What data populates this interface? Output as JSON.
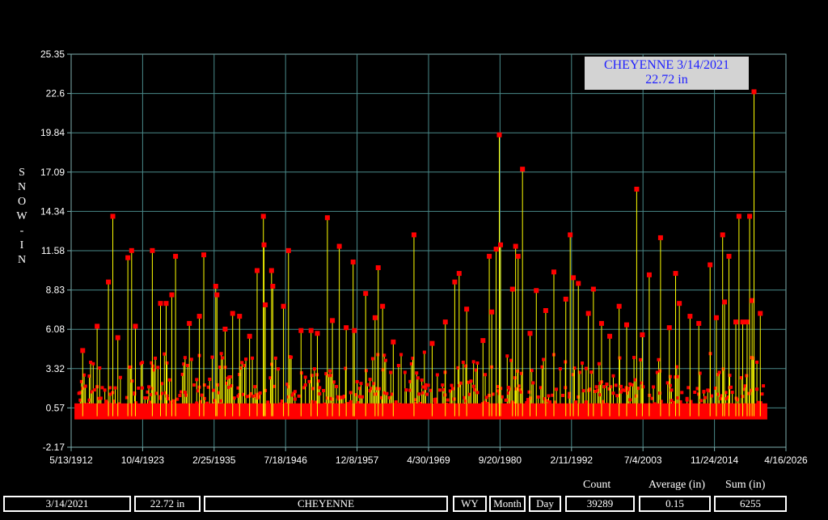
{
  "chart_data": {
    "type": "bar",
    "title": "",
    "ylabel": "SNOW-IN",
    "ylim": [
      -2.17,
      25.35
    ],
    "yticks": [
      "25.35",
      "22.6",
      "19.84",
      "17.09",
      "14.34",
      "11.58",
      "8.83",
      "6.08",
      "3.32",
      "0.57",
      "-2.17"
    ],
    "xticks": [
      "5/13/1912",
      "10/4/1923",
      "2/25/1935",
      "7/18/1946",
      "12/8/1957",
      "4/30/1969",
      "9/20/1980",
      "2/11/1992",
      "7/4/2003",
      "11/24/2014",
      "4/16/2026"
    ],
    "xrange_years": [
      1912.36,
      2026.29
    ],
    "grid": true,
    "series": [
      {
        "marker_color": "#ff0000",
        "line_color": "#ffff00",
        "points": [
          [
            1914.2,
            4.6
          ],
          [
            1916.5,
            6.3
          ],
          [
            1918.3,
            9.4
          ],
          [
            1919.0,
            14.0
          ],
          [
            1919.8,
            5.5
          ],
          [
            1921.4,
            11.1
          ],
          [
            1922.0,
            11.6
          ],
          [
            1922.6,
            6.3
          ],
          [
            1925.3,
            11.6
          ],
          [
            1926.6,
            7.9
          ],
          [
            1927.5,
            7.9
          ],
          [
            1928.4,
            8.5
          ],
          [
            1929.0,
            11.2
          ],
          [
            1931.2,
            6.5
          ],
          [
            1932.8,
            7.0
          ],
          [
            1933.5,
            11.3
          ],
          [
            1935.4,
            9.1
          ],
          [
            1935.6,
            8.5
          ],
          [
            1936.9,
            6.1
          ],
          [
            1938.1,
            7.2
          ],
          [
            1939.2,
            7.0
          ],
          [
            1940.8,
            5.6
          ],
          [
            1942.0,
            10.2
          ],
          [
            1943.0,
            14.0
          ],
          [
            1943.1,
            12.0
          ],
          [
            1943.3,
            7.8
          ],
          [
            1944.3,
            10.2
          ],
          [
            1944.5,
            9.1
          ],
          [
            1946.2,
            7.7
          ],
          [
            1947.0,
            11.6
          ],
          [
            1949.0,
            6.0
          ],
          [
            1950.6,
            6.0
          ],
          [
            1951.6,
            5.8
          ],
          [
            1953.2,
            13.9
          ],
          [
            1954.0,
            6.7
          ],
          [
            1955.1,
            11.9
          ],
          [
            1956.2,
            6.2
          ],
          [
            1957.3,
            10.8
          ],
          [
            1957.5,
            6.0
          ],
          [
            1959.3,
            8.6
          ],
          [
            1960.8,
            6.9
          ],
          [
            1961.3,
            10.4
          ],
          [
            1962.0,
            7.7
          ],
          [
            1963.7,
            5.2
          ],
          [
            1967.0,
            12.7
          ],
          [
            1969.9,
            5.1
          ],
          [
            1972.0,
            6.6
          ],
          [
            1973.5,
            9.4
          ],
          [
            1974.2,
            10.0
          ],
          [
            1975.4,
            7.5
          ],
          [
            1978.0,
            5.3
          ],
          [
            1979.0,
            11.2
          ],
          [
            1979.4,
            7.3
          ],
          [
            1980.1,
            11.7
          ],
          [
            1980.6,
            19.7
          ],
          [
            1980.8,
            12.0
          ],
          [
            1982.7,
            8.9
          ],
          [
            1983.2,
            11.9
          ],
          [
            1983.6,
            11.2
          ],
          [
            1984.3,
            17.3
          ],
          [
            1985.5,
            5.8
          ],
          [
            1986.5,
            8.8
          ],
          [
            1988.0,
            7.4
          ],
          [
            1989.3,
            10.1
          ],
          [
            1991.2,
            8.2
          ],
          [
            1991.9,
            12.7
          ],
          [
            1992.4,
            9.7
          ],
          [
            1993.2,
            9.3
          ],
          [
            1994.8,
            7.2
          ],
          [
            1995.6,
            8.9
          ],
          [
            1996.9,
            6.5
          ],
          [
            1998.2,
            5.6
          ],
          [
            1999.7,
            7.7
          ],
          [
            2000.9,
            6.4
          ],
          [
            2002.5,
            15.9
          ],
          [
            2003.4,
            5.7
          ],
          [
            2004.5,
            9.9
          ],
          [
            2006.3,
            12.5
          ],
          [
            2007.7,
            6.2
          ],
          [
            2008.7,
            10.0
          ],
          [
            2009.3,
            7.9
          ],
          [
            2011.0,
            7.0
          ],
          [
            2012.4,
            6.5
          ],
          [
            2014.2,
            10.6
          ],
          [
            2015.2,
            6.9
          ],
          [
            2016.2,
            12.7
          ],
          [
            2016.5,
            8.0
          ],
          [
            2017.2,
            11.2
          ],
          [
            2018.3,
            6.6
          ],
          [
            2018.8,
            14.0
          ],
          [
            2019.4,
            6.6
          ],
          [
            2020.1,
            6.6
          ],
          [
            2020.5,
            14.0
          ],
          [
            2020.9,
            8.1
          ],
          [
            2021.2,
            22.72
          ],
          [
            2022.2,
            7.2
          ]
        ]
      }
    ]
  },
  "callout": {
    "line1": "CHEYENNE 3/14/2021",
    "line2": "22.72 in"
  },
  "stats": {
    "date": "3/14/2021",
    "value": "22.72 in",
    "station": "CHEYENNE",
    "wy_label": "WY",
    "month_label": "Month",
    "day_label": "Day",
    "count_label": "Count",
    "count": "39289",
    "average_label": "Average (in)",
    "average": "0.15",
    "sum_label": "Sum (in)",
    "sum": "6255"
  },
  "colors": {
    "grid": "#4a8a8a",
    "axis": "#7fb0b0",
    "marker": "#ff0000",
    "stem": "#ffff00",
    "callout_text": "#2020ff",
    "callout_bg": "#d3d3d3"
  }
}
